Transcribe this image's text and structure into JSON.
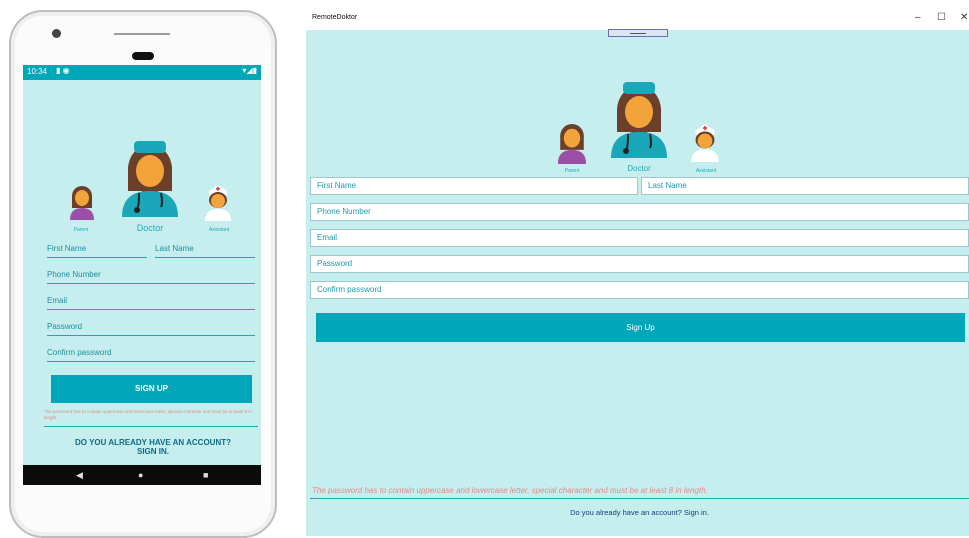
{
  "mobile": {
    "status": {
      "time": "10:34",
      "left_icons": "▮ ◉",
      "right_icons": "▾◢▮"
    },
    "roles": {
      "parent": "Parent",
      "doctor": "Doctor",
      "assistant": "Assistant"
    },
    "fields": {
      "first_name": "First Name",
      "last_name": "Last Name",
      "phone": "Phone Number",
      "email": "Email",
      "password": "Password",
      "confirm_password": "Confirm password"
    },
    "signup_label": "SIGN UP",
    "password_hint": "The password has to contain uppercase and lowercase letter, special character and must be at least 8 in length.",
    "question_line1": "DO YOU ALREADY HAVE AN ACCOUNT?",
    "question_line2": "SIGN IN.",
    "nav": {
      "back": "◀",
      "home": "●",
      "recent": "■"
    }
  },
  "desktop": {
    "window_title": "RemoteDoktor",
    "window_controls": {
      "minimize": "–",
      "maximize": "☐",
      "close": "✕"
    },
    "roles": {
      "parent": "Parent",
      "doctor": "Doctor",
      "assistant": "Assistant"
    },
    "fields": {
      "first_name": "First Name",
      "last_name": "Last Name",
      "phone": "Phone Number",
      "email": "Email",
      "password": "Password",
      "confirm_password": "Confirm password"
    },
    "signup_label": "Sign Up",
    "password_hint": "The password has to contain uppercase and lowercase letter, special character and must be at least 8 in length.",
    "question": "Do you already have an account? Sign in."
  },
  "colors": {
    "background": "#c7eeee",
    "accent": "#00a7b9",
    "hint": "#e48a8a",
    "link": "#1a3b78"
  },
  "icons": [
    "parent-avatar-icon",
    "doctor-avatar-icon",
    "assistant-avatar-icon"
  ]
}
